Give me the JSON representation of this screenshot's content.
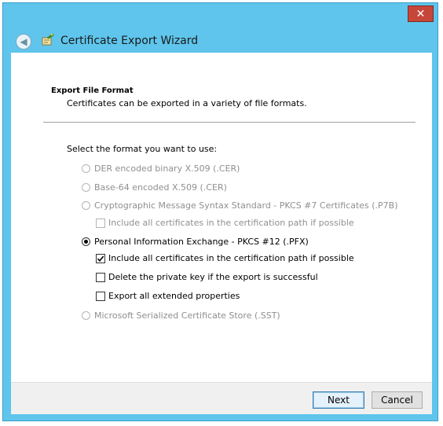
{
  "window": {
    "title": "Certificate Export Wizard",
    "close_glyph": "✕",
    "back_glyph": "◀"
  },
  "header": {
    "title": "Export File Format",
    "subtitle": "Certificates can be exported in a variety of file formats."
  },
  "body": {
    "prompt": "Select the format you want to use:",
    "options": [
      {
        "label": "DER encoded binary X.509 (.CER)",
        "enabled": false,
        "selected": false
      },
      {
        "label": "Base-64 encoded X.509 (.CER)",
        "enabled": false,
        "selected": false
      },
      {
        "label": "Cryptographic Message Syntax Standard - PKCS #7 Certificates (.P7B)",
        "enabled": false,
        "selected": false
      },
      {
        "label": "Personal Information Exchange - PKCS #12 (.PFX)",
        "enabled": true,
        "selected": true
      },
      {
        "label": "Microsoft Serialized Certificate Store (.SST)",
        "enabled": false,
        "selected": false
      }
    ],
    "p7b_include_all": {
      "label": "Include all certificates in the certification path if possible",
      "checked": false,
      "enabled": false
    },
    "pfx_checks": [
      {
        "label": "Include all certificates in the certification path if possible",
        "checked": true
      },
      {
        "label": "Delete the private key if the export is successful",
        "checked": false
      },
      {
        "label": "Export all extended properties",
        "checked": false
      }
    ]
  },
  "footer": {
    "next_label": "Next",
    "cancel_label": "Cancel"
  },
  "colors": {
    "frame": "#5fc5ec",
    "close": "#c7463a",
    "disabled_text": "#8f8f8f"
  },
  "icons": {
    "back": "back-arrow-icon",
    "wizard": "certificate-wizard-icon",
    "close": "close-icon"
  }
}
